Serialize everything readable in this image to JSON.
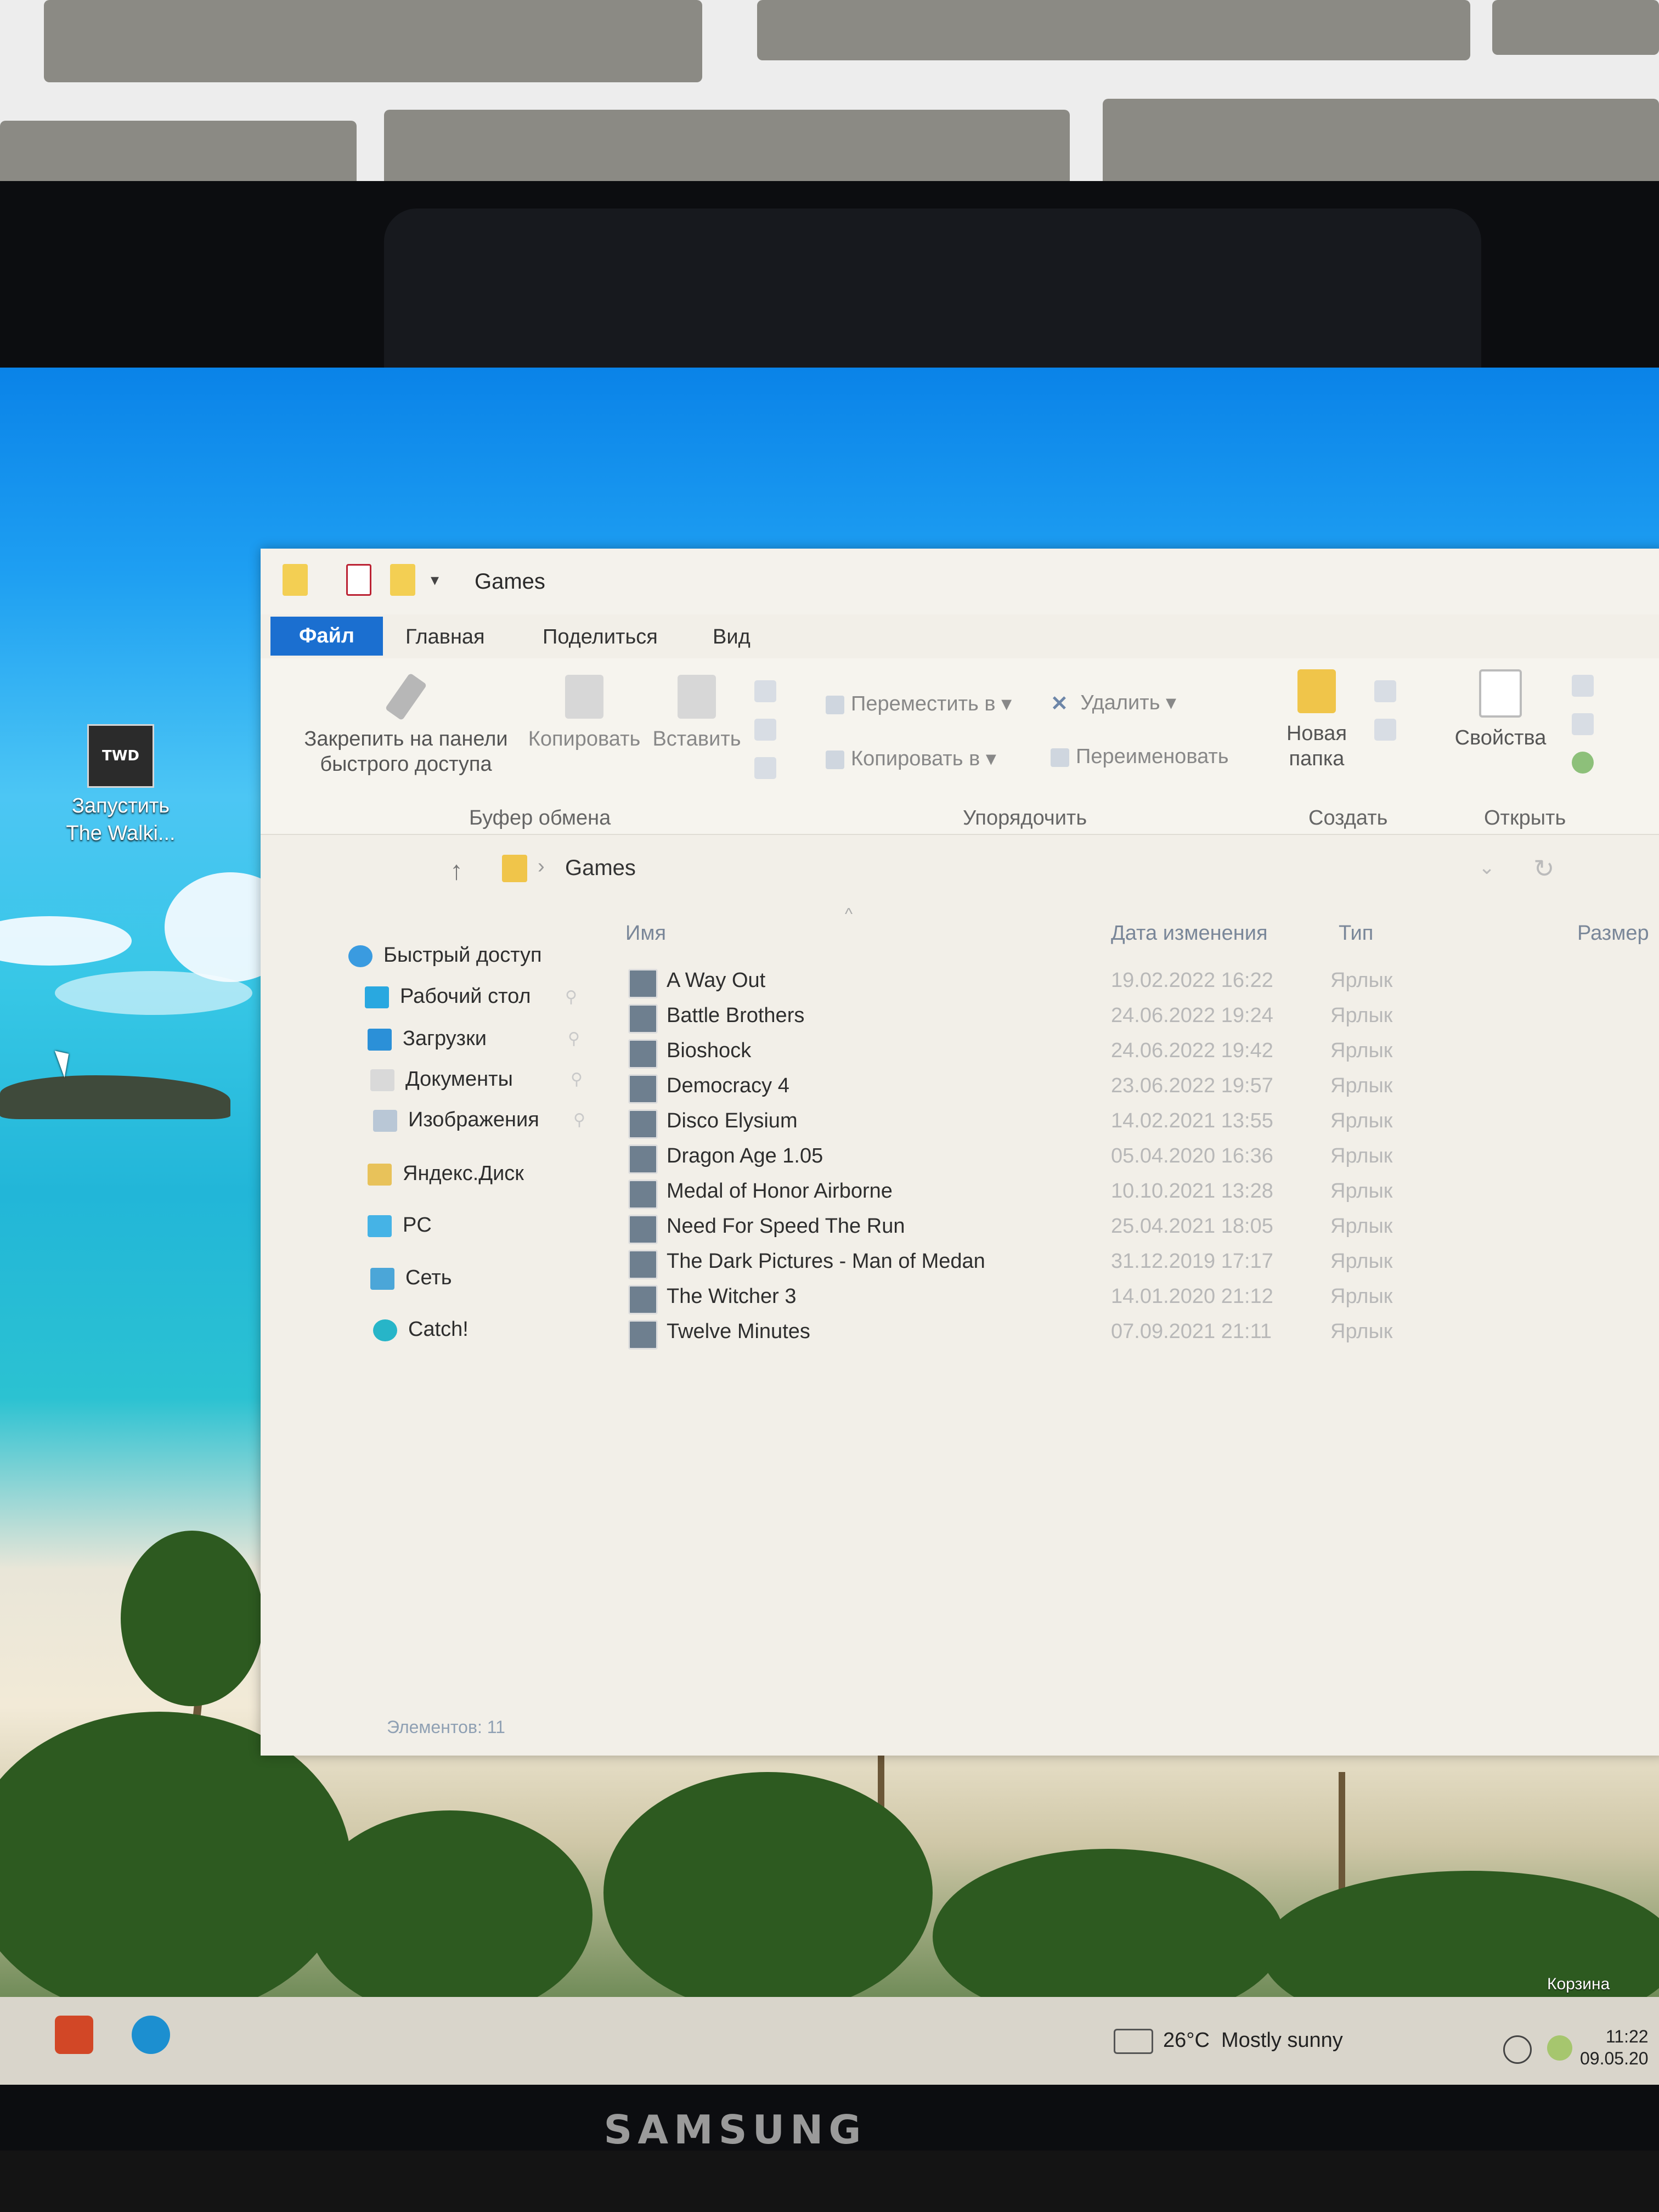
{
  "device": {
    "brand": "SAMSUNG"
  },
  "desktop": {
    "shortcut": {
      "icon": "walking-dead-game-icon",
      "line1": "Запустить",
      "line2": "The Walki..."
    },
    "recycle_bin": "Корзина"
  },
  "explorer": {
    "title": "Games",
    "tabs": {
      "file": "Файл",
      "home": "Главная",
      "share": "Поделиться",
      "view": "Вид"
    },
    "ribbon": {
      "pin_line1": "Закрепить на панели",
      "pin_line2": "быстрого доступа",
      "copy": "Копировать",
      "paste": "Вставить",
      "move_to": "Переместить в",
      "copy_to": "Копировать в",
      "delete": "Удалить",
      "rename": "Переименовать",
      "new_folder_line1": "Новая",
      "new_folder_line2": "папка",
      "properties": "Свойства",
      "group_clipboard": "Буфер обмена",
      "group_organize": "Упорядочить",
      "group_new": "Создать",
      "group_open": "Открыть"
    },
    "address": {
      "path": "Games"
    },
    "nav": {
      "quick_access": "Быстрый доступ",
      "desktop": "Рабочий стол",
      "downloads": "Загрузки",
      "documents": "Документы",
      "pictures": "Изображения",
      "yandex": "Яндекс.Диск",
      "pc": "PC",
      "network": "Сеть",
      "catch": "Catch!"
    },
    "columns": {
      "name": "Имя",
      "date": "Дата изменения",
      "type": "Тип",
      "size": "Размер"
    },
    "files": [
      {
        "name": "A Way Out",
        "date": "19.02.2022 16:22",
        "type": "Ярлык"
      },
      {
        "name": "Battle Brothers",
        "date": "24.06.2022 19:24",
        "type": "Ярлык"
      },
      {
        "name": "Bioshock",
        "date": "24.06.2022 19:42",
        "type": "Ярлык"
      },
      {
        "name": "Democracy 4",
        "date": "23.06.2022 19:57",
        "type": "Ярлык"
      },
      {
        "name": "Disco Elysium",
        "date": "14.02.2021 13:55",
        "type": "Ярлык"
      },
      {
        "name": "Dragon Age 1.05",
        "date": "05.04.2020 16:36",
        "type": "Ярлык"
      },
      {
        "name": "Medal of Honor Airborne",
        "date": "10.10.2021 13:28",
        "type": "Ярлык"
      },
      {
        "name": "Need For Speed The Run",
        "date": "25.04.2021 18:05",
        "type": "Ярлык"
      },
      {
        "name": "The Dark Pictures - Man of Medan",
        "date": "31.12.2019 17:17",
        "type": "Ярлык"
      },
      {
        "name": "The Witcher 3",
        "date": "14.01.2020 21:12",
        "type": "Ярлык"
      },
      {
        "name": "Twelve Minutes",
        "date": "07.09.2021 21:11",
        "type": "Ярлык"
      }
    ],
    "status": "Элементов: 11"
  },
  "taskbar": {
    "apps": [
      "powerpoint-icon",
      "edge-icon"
    ],
    "weather": {
      "temp": "26°C",
      "desc": "Mostly sunny"
    },
    "clock": {
      "time": "11:22",
      "date": "09.05.20"
    }
  }
}
